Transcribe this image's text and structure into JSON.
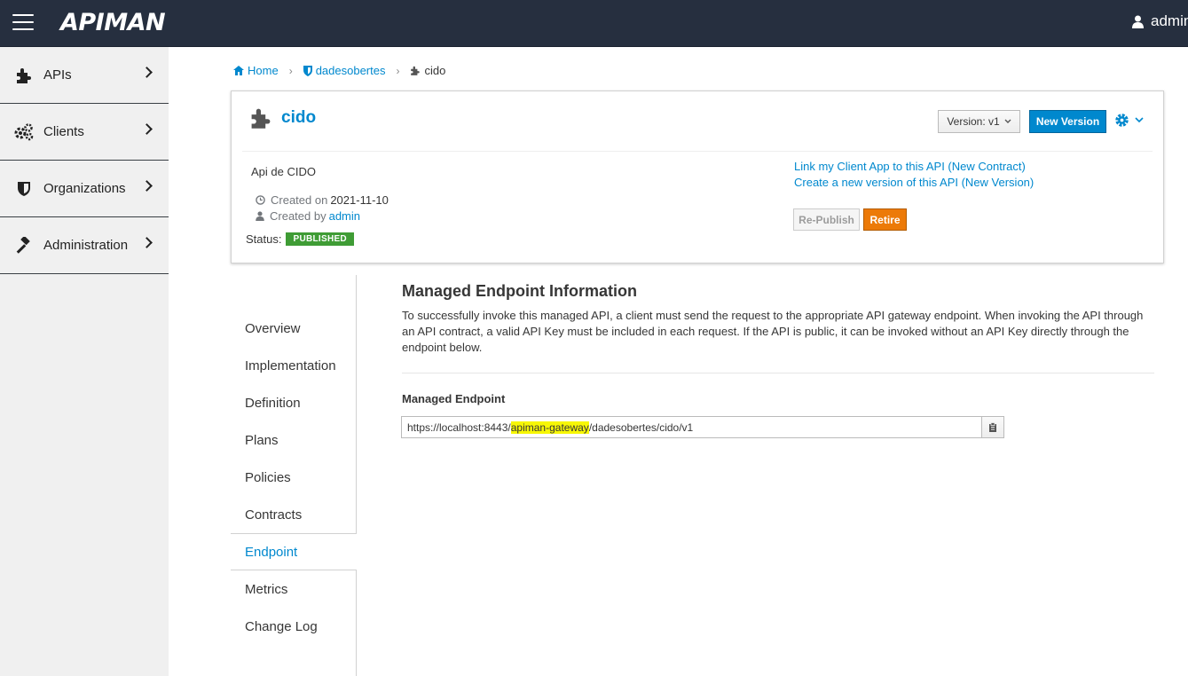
{
  "topbar": {
    "brand": "APIMAN",
    "user": "admin"
  },
  "sidebar": {
    "items": [
      {
        "label": "APIs",
        "icon": "puzzle-icon"
      },
      {
        "label": "Clients",
        "icon": "gears-icon"
      },
      {
        "label": "Organizations",
        "icon": "shield-icon"
      },
      {
        "label": "Administration",
        "icon": "gavel-icon"
      }
    ]
  },
  "breadcrumb": {
    "home": "Home",
    "org": "dadesobertes",
    "api": "cido"
  },
  "api": {
    "name": "cido",
    "description": "Api de CIDO",
    "created_on_label": "Created on",
    "created_on": "2021-11-10",
    "created_by_label": "Created by",
    "created_by": "admin",
    "status_label": "Status:",
    "status": "PUBLISHED"
  },
  "actions": {
    "version": "Version: v1",
    "new_version": "New Version",
    "link_contract": "Link my Client App to this API (New Contract)",
    "create_version": "Create a new version of this API (New Version)",
    "republish": "Re-Publish",
    "retire": "Retire"
  },
  "tabs": [
    {
      "label": "Overview"
    },
    {
      "label": "Implementation"
    },
    {
      "label": "Definition"
    },
    {
      "label": "Plans"
    },
    {
      "label": "Policies"
    },
    {
      "label": "Contracts"
    },
    {
      "label": "Endpoint"
    },
    {
      "label": "Metrics"
    },
    {
      "label": "Change Log"
    }
  ],
  "endpoint": {
    "title": "Managed Endpoint Information",
    "description": "To successfully invoke this managed API, a client must send the request to the appropriate API gateway endpoint. When invoking the API through an API contract, a valid API Key must be included in each request. If the API is public, it can be invoked without an API Key directly through the endpoint below.",
    "label": "Managed Endpoint",
    "url_prefix": "https://localhost:8443/",
    "url_highlight": "apiman-gateway",
    "url_suffix": "/dadesobertes/cido/v1"
  },
  "colors": {
    "accent": "#0088ce",
    "topbar": "#262f3f",
    "published": "#3f9c35",
    "retire": "#ec7a08",
    "highlight": "#f7f705"
  }
}
